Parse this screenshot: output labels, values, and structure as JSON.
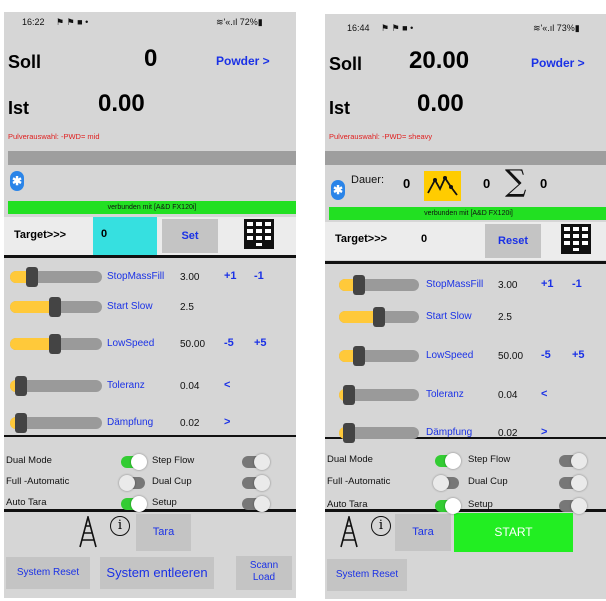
{
  "screen1": {
    "status": {
      "time": "16:22",
      "icons": "⚑ ⚑ ■ •",
      "battery": "≋'«.ıl 72%▮"
    },
    "soll_label": "Soll",
    "soll_value": "0",
    "powder_link": "Powder >",
    "ist_label": "Ist",
    "ist_value": "0.00",
    "pulver": "Pulverauswahl: -PWD= mid",
    "connected": "verbunden mit [A&D FX120i]",
    "target_label": "Target>>>",
    "target_value": "0",
    "set_label": "Set",
    "sliders": [
      {
        "label": "StopMassFill",
        "value": "3.00",
        "fill": 0.2,
        "a": "+1",
        "b": "-1"
      },
      {
        "label": "Start Slow",
        "value": "2.5",
        "fill": 0.45,
        "a": "",
        "b": ""
      },
      {
        "label": "LowSpeed",
        "value": "50.00",
        "fill": 0.45,
        "a": "-5",
        "b": "+5"
      },
      {
        "label": "Toleranz",
        "value": "0.04",
        "fill": 0.08,
        "a": "<",
        "b": ""
      },
      {
        "label": "Dämpfung",
        "value": "0.02",
        "fill": 0.08,
        "a": ">",
        "b": ""
      }
    ],
    "switches": [
      {
        "label": "Dual Mode",
        "on": true,
        "label2": "Step Flow",
        "on2": false
      },
      {
        "label": "Full -Automatic",
        "on": false,
        "label2": "Dual Cup",
        "on2": false
      },
      {
        "label": "Auto Tara",
        "on": true,
        "label2": "Setup",
        "on2": false
      }
    ],
    "tara_label": "Tara",
    "bottom": {
      "reset": "System Reset",
      "entleeren": "System entleeren",
      "scann": "Scann",
      "load": "Load"
    }
  },
  "screen2": {
    "status": {
      "time": "16:44",
      "icons": "⚑ ⚑ ■ •",
      "battery": "≋'«.ıl 73%▮"
    },
    "soll_label": "Soll",
    "soll_value": "20.00",
    "powder_link": "Powder >",
    "ist_label": "Ist",
    "ist_value": "0.00",
    "pulver": "Pulverauswahl: -PWD= sheavy",
    "dauer_label": "Dauer:",
    "dauer_value": "0",
    "wave_value": "0",
    "sum_value": "0",
    "connected": "verbunden mit [A&D FX120i]",
    "target_label": "Target>>>",
    "target_value": "0",
    "reset_label": "Reset",
    "sliders": [
      {
        "label": "StopMassFill",
        "value": "3.00",
        "fill": 0.2,
        "a": "+1",
        "b": "-1"
      },
      {
        "label": "Start Slow",
        "value": "2.5",
        "fill": 0.45,
        "a": "",
        "b": ""
      },
      {
        "label": "LowSpeed",
        "value": "50.00",
        "fill": 0.2,
        "a": "-5",
        "b": "+5"
      },
      {
        "label": "Toleranz",
        "value": "0.04",
        "fill": 0.08,
        "a": "<",
        "b": ""
      },
      {
        "label": "Dämpfung",
        "value": "0.02",
        "fill": 0.08,
        "a": ">",
        "b": ""
      }
    ],
    "switches": [
      {
        "label": "Dual Mode",
        "on": true,
        "label2": "Step Flow",
        "on2": false
      },
      {
        "label": "Full -Automatic",
        "on": false,
        "label2": "Dual Cup",
        "on2": false
      },
      {
        "label": "Auto Tara",
        "on": true,
        "label2": "Setup",
        "on2": false
      }
    ],
    "tara_label": "Tara",
    "start_label": "START",
    "bottom": {
      "reset": "System Reset"
    }
  },
  "colors": {
    "accent_blue": "#1a31e6",
    "status_green": "#22e022",
    "slider_yellow": "#ffc93a",
    "cyan": "#36e0e0",
    "wave_yellow": "#ffcc00"
  }
}
